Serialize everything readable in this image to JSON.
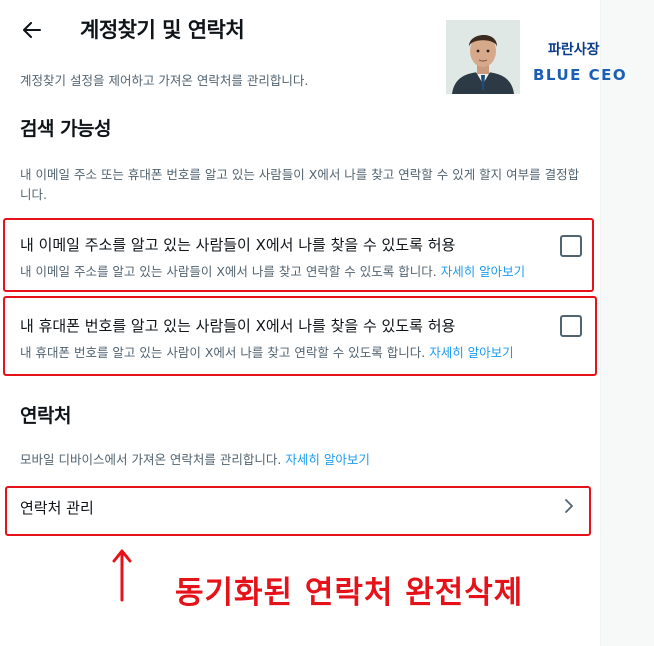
{
  "header": {
    "title": "계정찾기 및 연락처",
    "subtitle": "계정찾기 설정을 제어하고 가져온 연락처를 관리합니다."
  },
  "brand": {
    "name_ko": "파란사장",
    "name_en": "BLUE CEO"
  },
  "discoverability": {
    "heading": "검색 가능성",
    "description": "내 이메일 주소 또는 휴대폰 번호를 알고 있는 사람들이 X에서 나를 찾고 연락할 수 있게 할지 여부를 결정합니다.",
    "settings": [
      {
        "label": "내 이메일 주소를 알고 있는 사람들이 X에서 나를 찾을 수 있도록 허용",
        "hint": "내 이메일 주소를 알고 있는 사람들이 X에서 나를 찾고 연락할 수 있도록 합니다.",
        "link": "자세히 알아보기",
        "checked": false
      },
      {
        "label": "내 휴대폰 번호를 알고 있는 사람들이 X에서 나를 찾을 수 있도록 허용",
        "hint": "내 휴대폰 번호를 알고 있는 사람이 X에서 나를 찾고 연락할 수 있도록 합니다.",
        "link": "자세히 알아보기",
        "checked": false
      }
    ]
  },
  "contacts": {
    "heading": "연락처",
    "description": "모바일 디바이스에서 가져온 연락처를 관리합니다.",
    "link": "자세히 알아보기",
    "manage_label": "연락처 관리"
  },
  "annotation": {
    "text": "동기화된 연락처 완전삭제",
    "color": "#e6121a"
  },
  "colors": {
    "link": "#1d9bf0",
    "secondary_text": "#536471",
    "highlight": "#e6121a"
  }
}
